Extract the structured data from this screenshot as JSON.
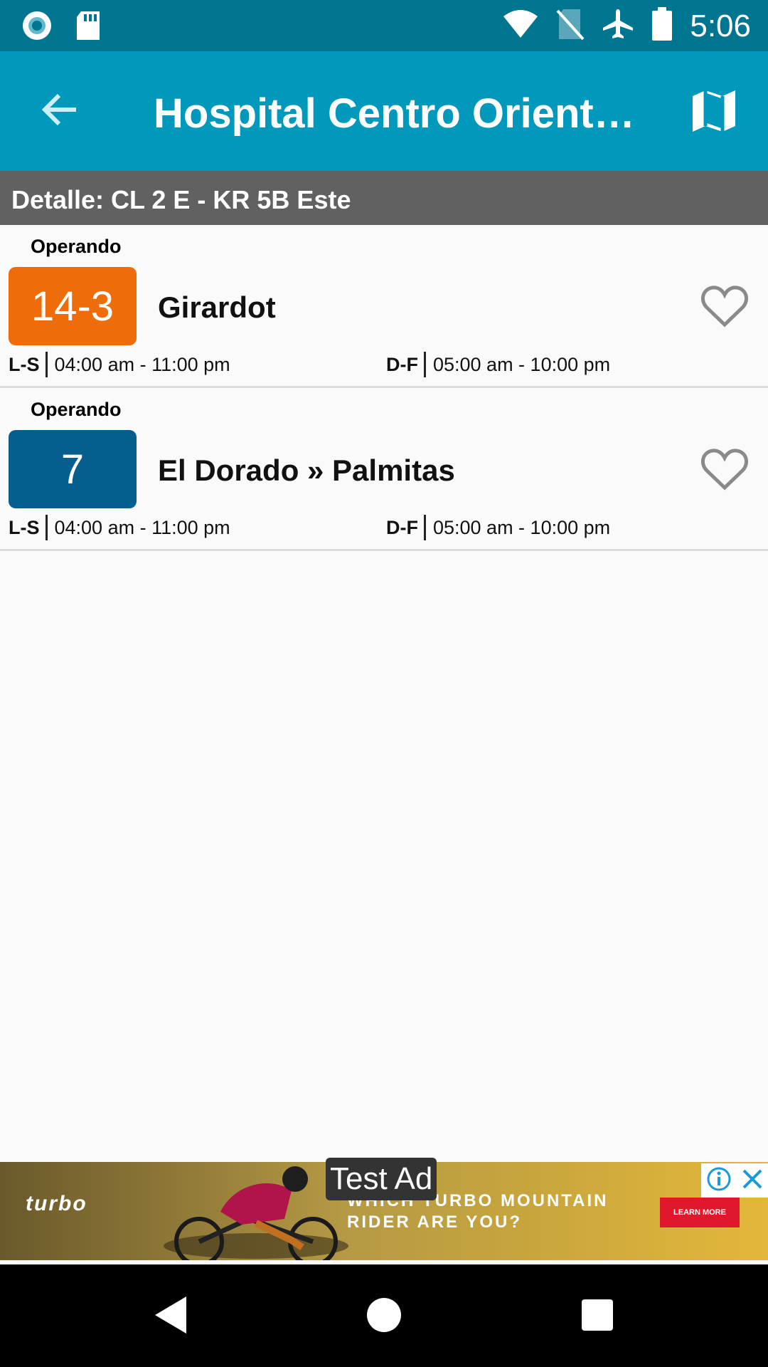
{
  "status_bar": {
    "time": "5:06",
    "icons": [
      "circle-notification-icon",
      "sd-card-icon",
      "wifi-icon",
      "no-sim-icon",
      "airplane-icon",
      "battery-icon"
    ]
  },
  "app_bar": {
    "title": "Hospital Centro Oriental…",
    "icons": [
      "back-arrow-icon",
      "map-icon"
    ]
  },
  "detail": {
    "label": "Detalle: CL 2 E - KR 5B Este"
  },
  "routes": [
    {
      "status": "Operando",
      "code": "14-3",
      "color": "#ef6c0b",
      "name": "Girardot",
      "schedule": [
        {
          "days": "L-S",
          "hours": "04:00 am - 11:00 pm"
        },
        {
          "days": "D-F",
          "hours": "05:00 am - 10:00 pm"
        }
      ]
    },
    {
      "status": "Operando",
      "code": "7",
      "color": "#045f8f",
      "name": "El Dorado » Palmitas",
      "schedule": [
        {
          "days": "L-S",
          "hours": "04:00 am - 11:00 pm"
        },
        {
          "days": "D-F",
          "hours": "05:00 am - 10:00 pm"
        }
      ]
    }
  ],
  "ad": {
    "label": "Test Ad",
    "headline": "WHICH TURBO MOUNTAIN\nRIDER ARE YOU?",
    "cta": "LEARN MORE"
  },
  "nav_bar": {
    "icons": [
      "back-triangle-icon",
      "home-circle-icon",
      "recents-square-icon"
    ]
  }
}
